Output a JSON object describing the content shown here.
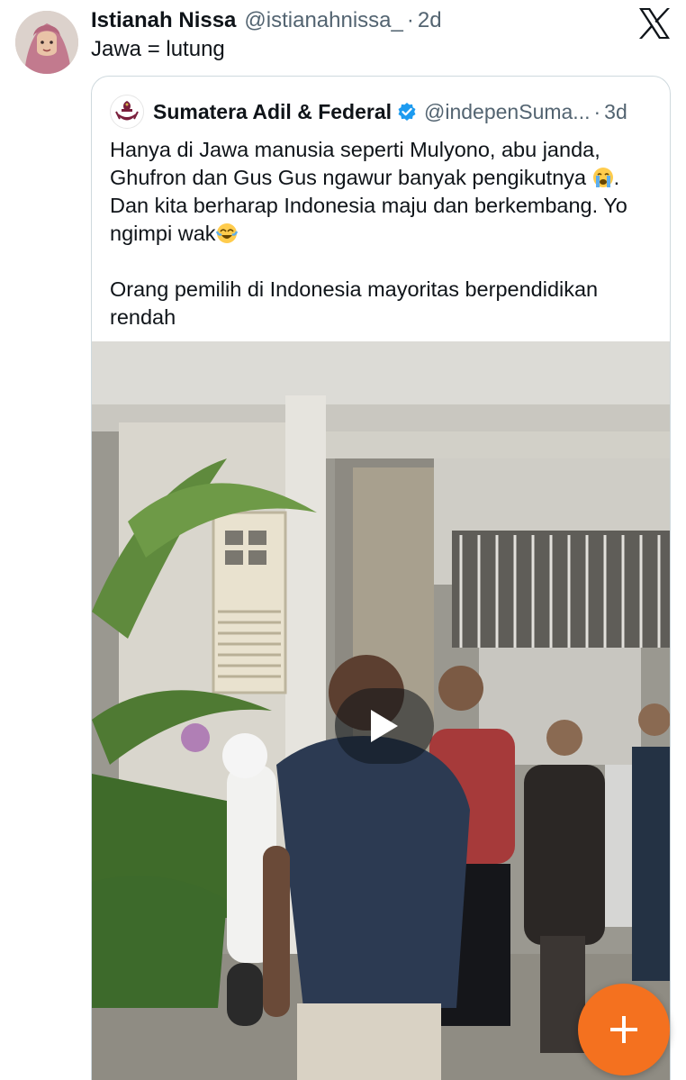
{
  "tweet": {
    "author_name": "Istianah Nissa",
    "author_handle": "@istianahnissa_",
    "separator": "·",
    "time": "2d",
    "text": "Jawa = lutung",
    "avatar_icon": "profile-photo-hijab"
  },
  "app": {
    "logo_icon": "x-logo-icon"
  },
  "quoted_tweet": {
    "author_name": "Sumatera Adil & Federal",
    "author_handle": "@indepenSuma...",
    "separator": "·",
    "time": "3d",
    "verified_icon": "verified-badge-icon",
    "verified_color": "#1d9bf0",
    "text_line_1": "Hanya di Jawa manusia seperti Mulyono, abu janda,",
    "text_line_2": "Ghufron dan Gus Gus ngawur banyak pengikutnya",
    "text_line_2_end": ".",
    "text_line_3": "Dan kita berharap Indonesia maju dan berkembang. Yo",
    "text_line_4": "ngimpi wak",
    "text_line_5": "Orang pemilih di Indonesia mayoritas berpendidikan",
    "text_line_6": "rendah",
    "emoji_1": "loudly-crying-face-emoji",
    "emoji_2": "face-with-tears-of-joy-emoji",
    "media": {
      "type": "video",
      "play_icon": "play-icon"
    }
  },
  "fab": {
    "icon": "plus-icon",
    "color": "#f4711f"
  }
}
